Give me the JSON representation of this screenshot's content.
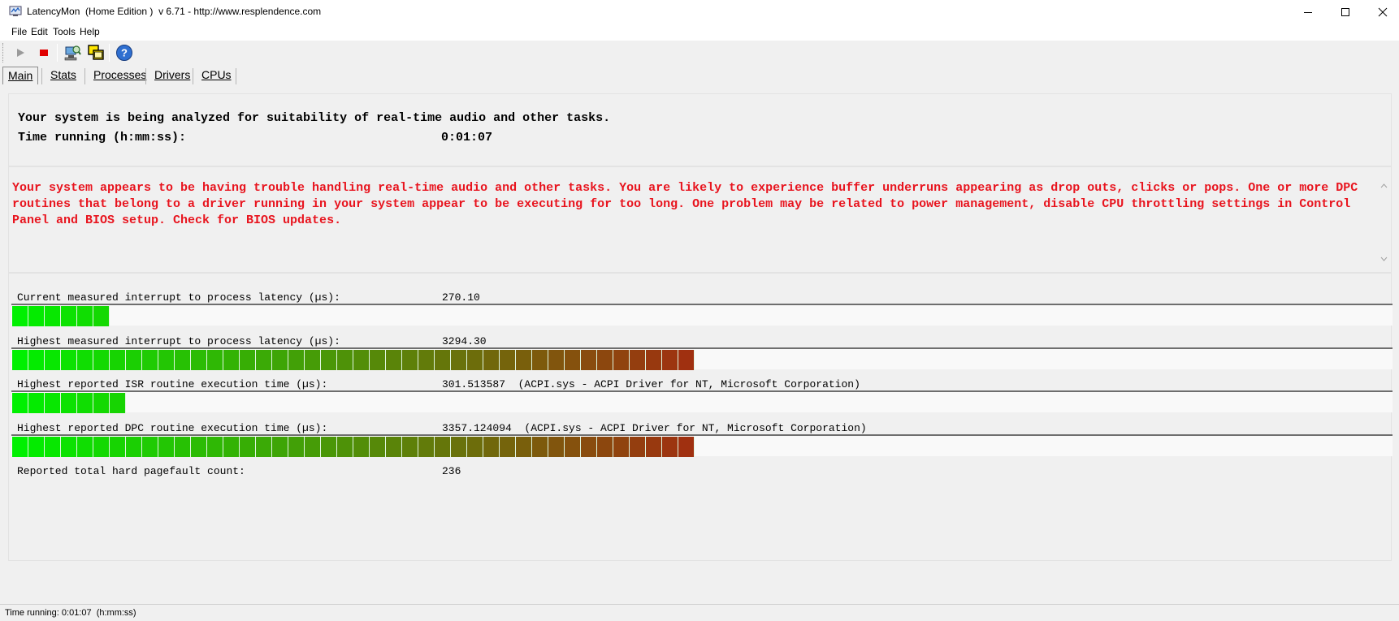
{
  "window": {
    "title": "LatencyMon  (Home Edition )  v 6.71 - http://www.resplendence.com",
    "icon": "latencymon-app-icon"
  },
  "menu": [
    {
      "label": "File"
    },
    {
      "label": "Edit"
    },
    {
      "label": "Tools"
    },
    {
      "label": "Help"
    }
  ],
  "toolbar": {
    "buttons": [
      "play-icon",
      "stop-icon",
      "computer-analyze-icon",
      "windows-overlap-icon",
      "help-icon"
    ]
  },
  "tabs": [
    {
      "label": "Main",
      "active": true
    },
    {
      "label": "Stats"
    },
    {
      "label": "Processes"
    },
    {
      "label": "Drivers"
    },
    {
      "label": "CPUs"
    }
  ],
  "status_panel": {
    "headline": "Your system is being analyzed for suitability of real-time audio and other tasks.",
    "time_label": "Time running (h:mm:ss):",
    "time_value": "0:01:07"
  },
  "verdict": {
    "text": "Your system appears to be having trouble handling real-time audio and other tasks. You are likely to experience buffer underruns appearing as drop outs, clicks or pops. One or more DPC routines that belong to a driver running in your system appear to be executing for too long. One problem may be related to power management, disable CPU throttling settings in Control Panel and BIOS setup. Check for BIOS updates.",
    "color": "#e8141e"
  },
  "measurements": [
    {
      "label": "Current measured interrupt to process latency (µs):",
      "value": "270.10",
      "level_segments": 6
    },
    {
      "label": "Highest measured interrupt to process latency (µs):",
      "value": "3294.30",
      "level_segments": 42
    },
    {
      "label": "Highest reported ISR routine execution time (µs):",
      "value": "301.513587  (ACPI.sys - ACPI Driver for NT, Microsoft Corporation)",
      "level_segments": 7
    },
    {
      "label": "Highest reported DPC routine execution time (µs):",
      "value": "3357.124094  (ACPI.sys - ACPI Driver for NT, Microsoft Corporation)",
      "level_segments": 42
    },
    {
      "label": "Reported total hard pagefault count:",
      "value": "236"
    }
  ],
  "bar_colors": {
    "start": "#00f000",
    "end": "#a03010"
  },
  "statusbar": {
    "text": "Time running: 0:01:07  (h:mm:ss)"
  }
}
